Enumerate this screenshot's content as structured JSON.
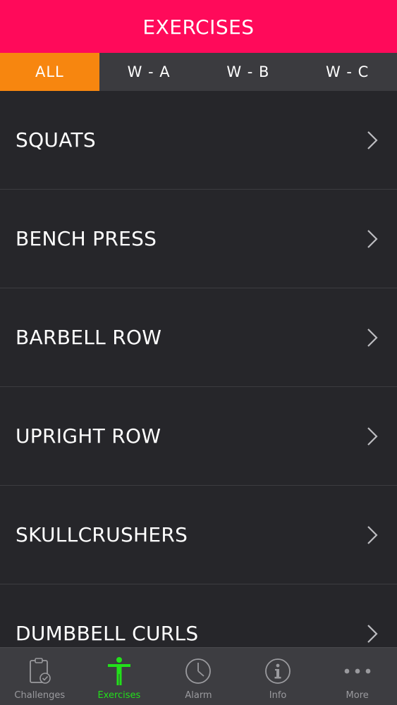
{
  "header": {
    "title": "EXERCISES"
  },
  "tabs": [
    {
      "label": "ALL",
      "active": true
    },
    {
      "label": "W - A",
      "active": false
    },
    {
      "label": "W - B",
      "active": false
    },
    {
      "label": "W - C",
      "active": false
    }
  ],
  "exercises": [
    {
      "label": "SQUATS",
      "icon": "chevron-right-icon"
    },
    {
      "label": "BENCH PRESS",
      "icon": "chevron-right-icon"
    },
    {
      "label": "BARBELL ROW",
      "icon": "chevron-right-icon"
    },
    {
      "label": "UPRIGHT ROW",
      "icon": "chevron-right-icon"
    },
    {
      "label": "SKULLCRUSHERS",
      "icon": "chevron-right-icon"
    },
    {
      "label": "DUMBBELL CURLS",
      "icon": "chevron-right-icon"
    }
  ],
  "tabbar": [
    {
      "label": "Challenges",
      "icon": "clipboard-check-icon",
      "active": false
    },
    {
      "label": "Exercises",
      "icon": "person-icon",
      "active": true
    },
    {
      "label": "Alarm",
      "icon": "clock-icon",
      "active": false
    },
    {
      "label": "Info",
      "icon": "info-icon",
      "active": false
    },
    {
      "label": "More",
      "icon": "more-dots-icon",
      "active": false
    }
  ],
  "colors": {
    "header_bg": "#ff0a5a",
    "active_tab_bg": "#f7860f",
    "tabs_bg": "#3b3b3f",
    "list_bg": "#26262a",
    "tabbar_bg": "#3d3d41",
    "tabbar_active": "#22e01a",
    "tabbar_inactive": "#9a9a9e"
  }
}
